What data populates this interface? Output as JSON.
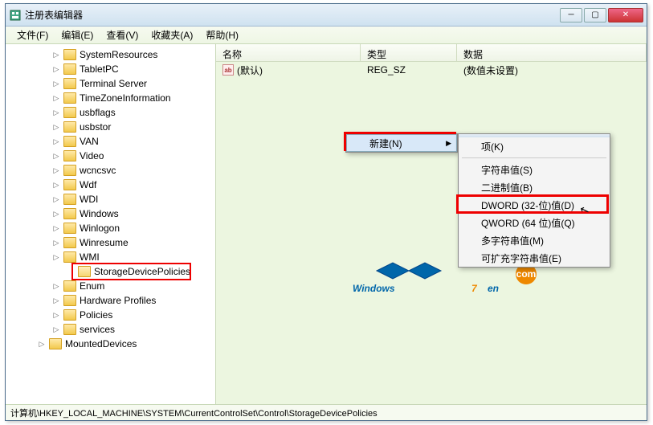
{
  "window": {
    "title": "注册表编辑器"
  },
  "menu": {
    "file": "文件(F)",
    "edit": "编辑(E)",
    "view": "查看(V)",
    "fav": "收藏夹(A)",
    "help": "帮助(H)"
  },
  "tree": [
    {
      "label": "SystemResources",
      "cls": ""
    },
    {
      "label": "TabletPC",
      "cls": ""
    },
    {
      "label": "Terminal Server",
      "cls": ""
    },
    {
      "label": "TimeZoneInformation",
      "cls": ""
    },
    {
      "label": "usbflags",
      "cls": ""
    },
    {
      "label": "usbstor",
      "cls": ""
    },
    {
      "label": "VAN",
      "cls": ""
    },
    {
      "label": "Video",
      "cls": ""
    },
    {
      "label": "wcncsvc",
      "cls": ""
    },
    {
      "label": "Wdf",
      "cls": ""
    },
    {
      "label": "WDI",
      "cls": ""
    },
    {
      "label": "Windows",
      "cls": ""
    },
    {
      "label": "Winlogon",
      "cls": ""
    },
    {
      "label": "Winresume",
      "cls": ""
    },
    {
      "label": "WMI",
      "cls": ""
    },
    {
      "label": "StorageDevicePolicies",
      "cls": "sdp open",
      "hl": true
    },
    {
      "label": "Enum",
      "cls": "enum"
    },
    {
      "label": "Hardware Profiles",
      "cls": "enum"
    },
    {
      "label": "Policies",
      "cls": "enum"
    },
    {
      "label": "services",
      "cls": "enum"
    },
    {
      "label": "MountedDevices",
      "cls": "mounted"
    }
  ],
  "listhdr": {
    "name": "名称",
    "type": "类型",
    "data": "数据"
  },
  "row": {
    "name": "(默认)",
    "type": "REG_SZ",
    "data": "(数值未设置)",
    "ico": "ab"
  },
  "ctx1": {
    "new": "新建(N)"
  },
  "ctx2": {
    "key": "项(K)",
    "string": "字符串值(S)",
    "binary": "二进制值(B)",
    "dword": "DWORD (32-位)值(D)",
    "qword": "QWORD (64 位)值(Q)",
    "multi": "多字符串值(M)",
    "expand": "可扩充字符串值(E)"
  },
  "status": "计算机\\HKEY_LOCAL_MACHINE\\SYSTEM\\CurrentControlSet\\Control\\StorageDevicePolicies",
  "logo": {
    "text1": "Windows",
    "text2": "7",
    "text3": "en",
    "badge": "com"
  }
}
